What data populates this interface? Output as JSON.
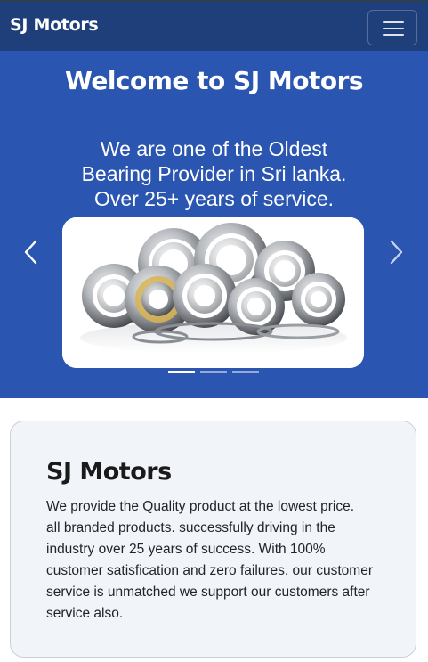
{
  "navbar": {
    "brand": "SJ Motors",
    "toggler_icon": "hamburger-menu-icon"
  },
  "hero": {
    "title": "Welcome to SJ Motors",
    "subtitle_lines": [
      "We are one of the Oldest",
      "Bearing Provider in Sri lanka.",
      "Over 25+ years of service."
    ],
    "prev_icon": "chevron-left-icon",
    "next_icon": "chevron-right-icon",
    "slide_image": "bearings-photo",
    "slide_count": 3,
    "active_slide": 1
  },
  "about": {
    "title": "SJ Motors",
    "text_lines": [
      "We provide the Quality product at the lowest price.",
      "all branded products. successfully driving in the",
      "industry over 25 years of success. With 100%",
      "customer satisfication and zero failures. our customer",
      "service is unmatched we support our customers after",
      "service also."
    ]
  },
  "colors": {
    "navbar": "#1f3f7a",
    "hero": "#2a55b0",
    "card_bg": "#f1f5fa"
  }
}
